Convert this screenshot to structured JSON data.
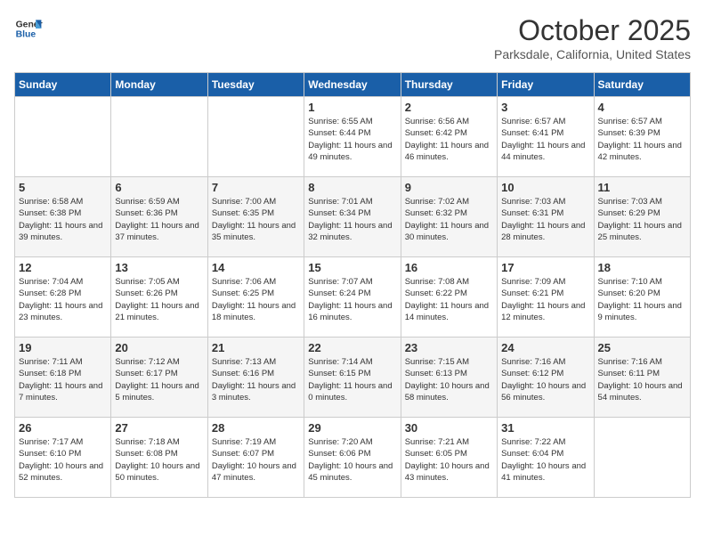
{
  "header": {
    "logo_line1": "General",
    "logo_line2": "Blue",
    "month": "October 2025",
    "location": "Parksdale, California, United States"
  },
  "days_of_week": [
    "Sunday",
    "Monday",
    "Tuesday",
    "Wednesday",
    "Thursday",
    "Friday",
    "Saturday"
  ],
  "weeks": [
    [
      {
        "num": "",
        "info": ""
      },
      {
        "num": "",
        "info": ""
      },
      {
        "num": "",
        "info": ""
      },
      {
        "num": "1",
        "info": "Sunrise: 6:55 AM\nSunset: 6:44 PM\nDaylight: 11 hours\nand 49 minutes."
      },
      {
        "num": "2",
        "info": "Sunrise: 6:56 AM\nSunset: 6:42 PM\nDaylight: 11 hours\nand 46 minutes."
      },
      {
        "num": "3",
        "info": "Sunrise: 6:57 AM\nSunset: 6:41 PM\nDaylight: 11 hours\nand 44 minutes."
      },
      {
        "num": "4",
        "info": "Sunrise: 6:57 AM\nSunset: 6:39 PM\nDaylight: 11 hours\nand 42 minutes."
      }
    ],
    [
      {
        "num": "5",
        "info": "Sunrise: 6:58 AM\nSunset: 6:38 PM\nDaylight: 11 hours\nand 39 minutes."
      },
      {
        "num": "6",
        "info": "Sunrise: 6:59 AM\nSunset: 6:36 PM\nDaylight: 11 hours\nand 37 minutes."
      },
      {
        "num": "7",
        "info": "Sunrise: 7:00 AM\nSunset: 6:35 PM\nDaylight: 11 hours\nand 35 minutes."
      },
      {
        "num": "8",
        "info": "Sunrise: 7:01 AM\nSunset: 6:34 PM\nDaylight: 11 hours\nand 32 minutes."
      },
      {
        "num": "9",
        "info": "Sunrise: 7:02 AM\nSunset: 6:32 PM\nDaylight: 11 hours\nand 30 minutes."
      },
      {
        "num": "10",
        "info": "Sunrise: 7:03 AM\nSunset: 6:31 PM\nDaylight: 11 hours\nand 28 minutes."
      },
      {
        "num": "11",
        "info": "Sunrise: 7:03 AM\nSunset: 6:29 PM\nDaylight: 11 hours\nand 25 minutes."
      }
    ],
    [
      {
        "num": "12",
        "info": "Sunrise: 7:04 AM\nSunset: 6:28 PM\nDaylight: 11 hours\nand 23 minutes."
      },
      {
        "num": "13",
        "info": "Sunrise: 7:05 AM\nSunset: 6:26 PM\nDaylight: 11 hours\nand 21 minutes."
      },
      {
        "num": "14",
        "info": "Sunrise: 7:06 AM\nSunset: 6:25 PM\nDaylight: 11 hours\nand 18 minutes."
      },
      {
        "num": "15",
        "info": "Sunrise: 7:07 AM\nSunset: 6:24 PM\nDaylight: 11 hours\nand 16 minutes."
      },
      {
        "num": "16",
        "info": "Sunrise: 7:08 AM\nSunset: 6:22 PM\nDaylight: 11 hours\nand 14 minutes."
      },
      {
        "num": "17",
        "info": "Sunrise: 7:09 AM\nSunset: 6:21 PM\nDaylight: 11 hours\nand 12 minutes."
      },
      {
        "num": "18",
        "info": "Sunrise: 7:10 AM\nSunset: 6:20 PM\nDaylight: 11 hours\nand 9 minutes."
      }
    ],
    [
      {
        "num": "19",
        "info": "Sunrise: 7:11 AM\nSunset: 6:18 PM\nDaylight: 11 hours\nand 7 minutes."
      },
      {
        "num": "20",
        "info": "Sunrise: 7:12 AM\nSunset: 6:17 PM\nDaylight: 11 hours\nand 5 minutes."
      },
      {
        "num": "21",
        "info": "Sunrise: 7:13 AM\nSunset: 6:16 PM\nDaylight: 11 hours\nand 3 minutes."
      },
      {
        "num": "22",
        "info": "Sunrise: 7:14 AM\nSunset: 6:15 PM\nDaylight: 11 hours\nand 0 minutes."
      },
      {
        "num": "23",
        "info": "Sunrise: 7:15 AM\nSunset: 6:13 PM\nDaylight: 10 hours\nand 58 minutes."
      },
      {
        "num": "24",
        "info": "Sunrise: 7:16 AM\nSunset: 6:12 PM\nDaylight: 10 hours\nand 56 minutes."
      },
      {
        "num": "25",
        "info": "Sunrise: 7:16 AM\nSunset: 6:11 PM\nDaylight: 10 hours\nand 54 minutes."
      }
    ],
    [
      {
        "num": "26",
        "info": "Sunrise: 7:17 AM\nSunset: 6:10 PM\nDaylight: 10 hours\nand 52 minutes."
      },
      {
        "num": "27",
        "info": "Sunrise: 7:18 AM\nSunset: 6:08 PM\nDaylight: 10 hours\nand 50 minutes."
      },
      {
        "num": "28",
        "info": "Sunrise: 7:19 AM\nSunset: 6:07 PM\nDaylight: 10 hours\nand 47 minutes."
      },
      {
        "num": "29",
        "info": "Sunrise: 7:20 AM\nSunset: 6:06 PM\nDaylight: 10 hours\nand 45 minutes."
      },
      {
        "num": "30",
        "info": "Sunrise: 7:21 AM\nSunset: 6:05 PM\nDaylight: 10 hours\nand 43 minutes."
      },
      {
        "num": "31",
        "info": "Sunrise: 7:22 AM\nSunset: 6:04 PM\nDaylight: 10 hours\nand 41 minutes."
      },
      {
        "num": "",
        "info": ""
      }
    ]
  ]
}
